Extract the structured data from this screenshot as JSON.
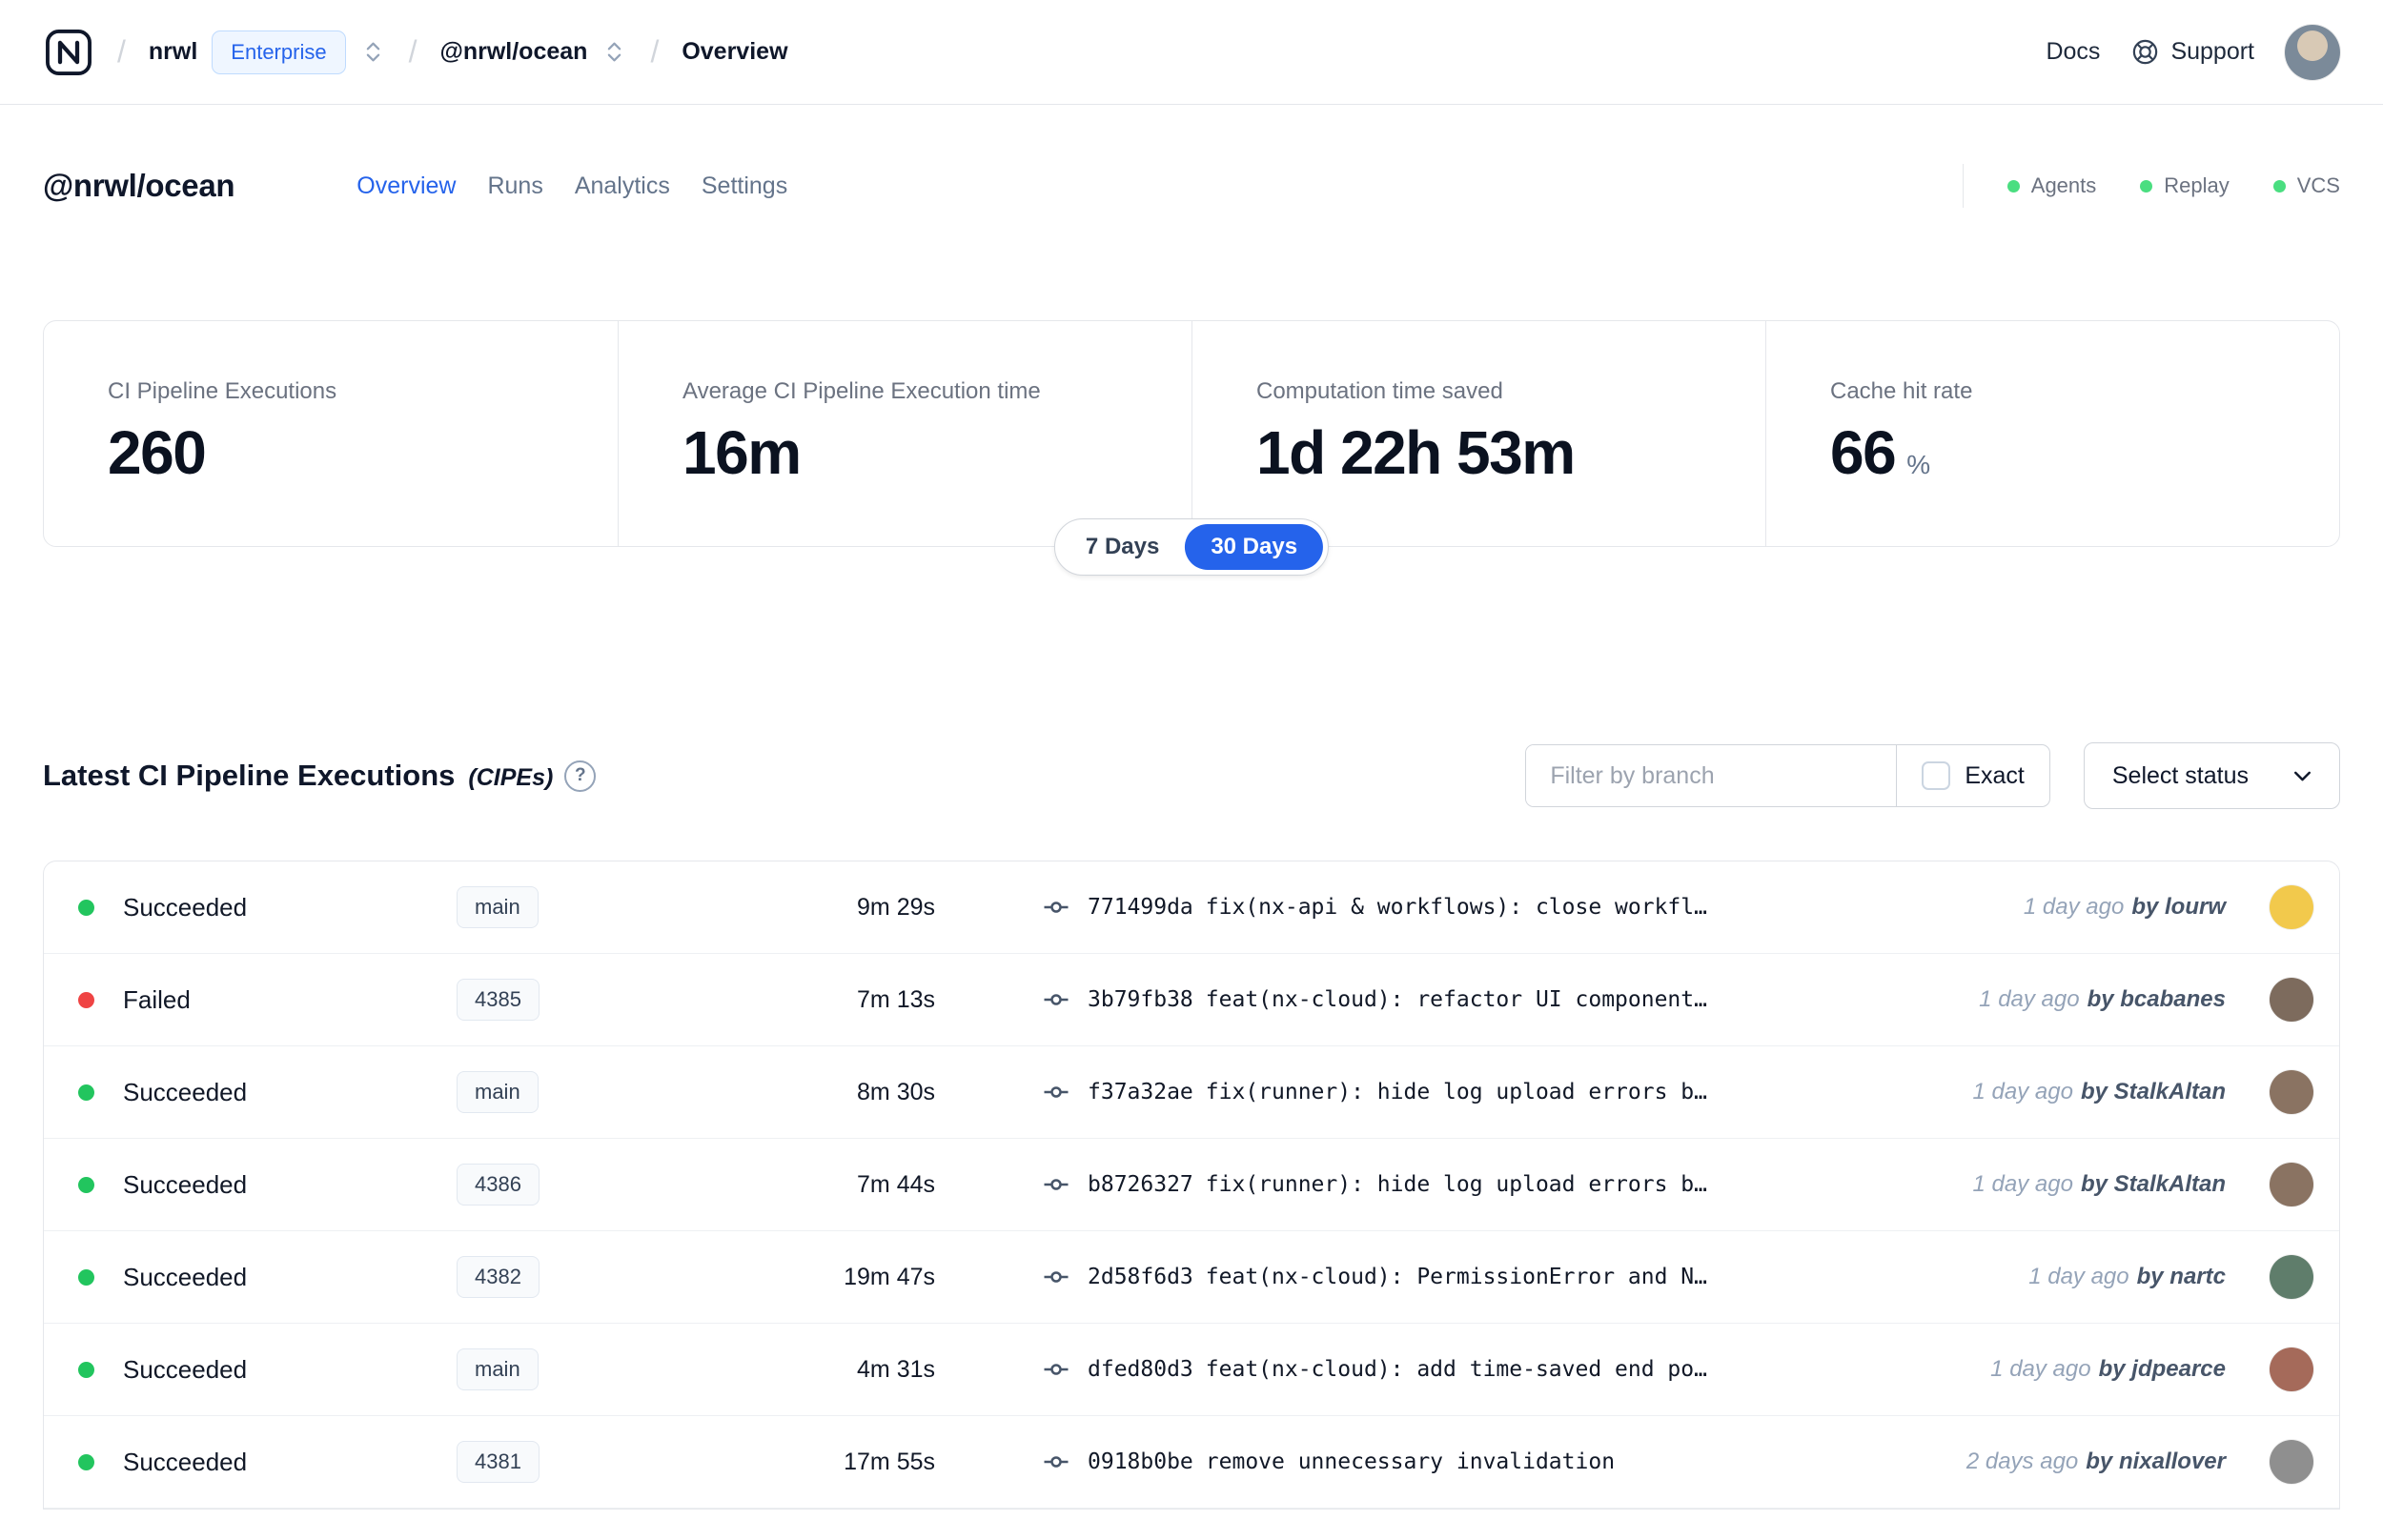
{
  "colors": {
    "accent": "#2563eb",
    "success": "#22c55e",
    "failure": "#ef4444",
    "online": "#4ade80"
  },
  "topbar": {
    "org": "nrwl",
    "plan_badge": "Enterprise",
    "workspace": "@nrwl/ocean",
    "page": "Overview",
    "docs_label": "Docs",
    "support_label": "Support"
  },
  "header": {
    "title": "@nrwl/ocean",
    "tabs": [
      {
        "label": "Overview",
        "active": true
      },
      {
        "label": "Runs",
        "active": false
      },
      {
        "label": "Analytics",
        "active": false
      },
      {
        "label": "Settings",
        "active": false
      }
    ],
    "statuses": [
      {
        "label": "Agents"
      },
      {
        "label": "Replay"
      },
      {
        "label": "VCS"
      }
    ]
  },
  "stats": {
    "cards": [
      {
        "label": "CI Pipeline Executions",
        "value": "260",
        "suffix": ""
      },
      {
        "label": "Average CI Pipeline Execution time",
        "value": "16m",
        "suffix": ""
      },
      {
        "label": "Computation time saved",
        "value": "1d 22h 53m",
        "suffix": ""
      },
      {
        "label": "Cache hit rate",
        "value": "66",
        "suffix": "%"
      }
    ],
    "range_toggle": {
      "options": [
        "7 Days",
        "30 Days"
      ],
      "active": "30 Days"
    }
  },
  "cipes": {
    "title": "Latest CI Pipeline Executions",
    "title_suffix": "(CIPEs)",
    "filter_placeholder": "Filter by branch",
    "exact_label": "Exact",
    "status_dropdown_label": "Select status",
    "rows": [
      {
        "status": "Succeeded",
        "status_key": "succeeded",
        "branch": "main",
        "duration": "9m 29s",
        "hash": "771499da",
        "message": "fix(nx-api & workflows): close workfl…",
        "time": "1 day ago",
        "author": "by lourw",
        "avatar_color": "#f2c94c"
      },
      {
        "status": "Failed",
        "status_key": "failed",
        "branch": "4385",
        "duration": "7m 13s",
        "hash": "3b79fb38",
        "message": "feat(nx-cloud): refactor UI component…",
        "time": "1 day ago",
        "author": "by bcabanes",
        "avatar_color": "#7d6b5d"
      },
      {
        "status": "Succeeded",
        "status_key": "succeeded",
        "branch": "main",
        "duration": "8m 30s",
        "hash": "f37a32ae",
        "message": "fix(runner): hide log upload errors b…",
        "time": "1 day ago",
        "author": "by StalkAltan",
        "avatar_color": "#8a7362"
      },
      {
        "status": "Succeeded",
        "status_key": "succeeded",
        "branch": "4386",
        "duration": "7m 44s",
        "hash": "b8726327",
        "message": "fix(runner): hide log upload errors b…",
        "time": "1 day ago",
        "author": "by StalkAltan",
        "avatar_color": "#8a7362"
      },
      {
        "status": "Succeeded",
        "status_key": "succeeded",
        "branch": "4382",
        "duration": "19m 47s",
        "hash": "2d58f6d3",
        "message": "feat(nx-cloud): PermissionError and N…",
        "time": "1 day ago",
        "author": "by nartc",
        "avatar_color": "#5f7d6b"
      },
      {
        "status": "Succeeded",
        "status_key": "succeeded",
        "branch": "main",
        "duration": "4m 31s",
        "hash": "dfed80d3",
        "message": "feat(nx-cloud): add time-saved end po…",
        "time": "1 day ago",
        "author": "by jdpearce",
        "avatar_color": "#a56a5a"
      },
      {
        "status": "Succeeded",
        "status_key": "succeeded",
        "branch": "4381",
        "duration": "17m 55s",
        "hash": "0918b0be",
        "message": "remove unnecessary invalidation",
        "time": "2 days ago",
        "author": "by nixallover",
        "avatar_color": "#8f8f8f"
      }
    ]
  }
}
